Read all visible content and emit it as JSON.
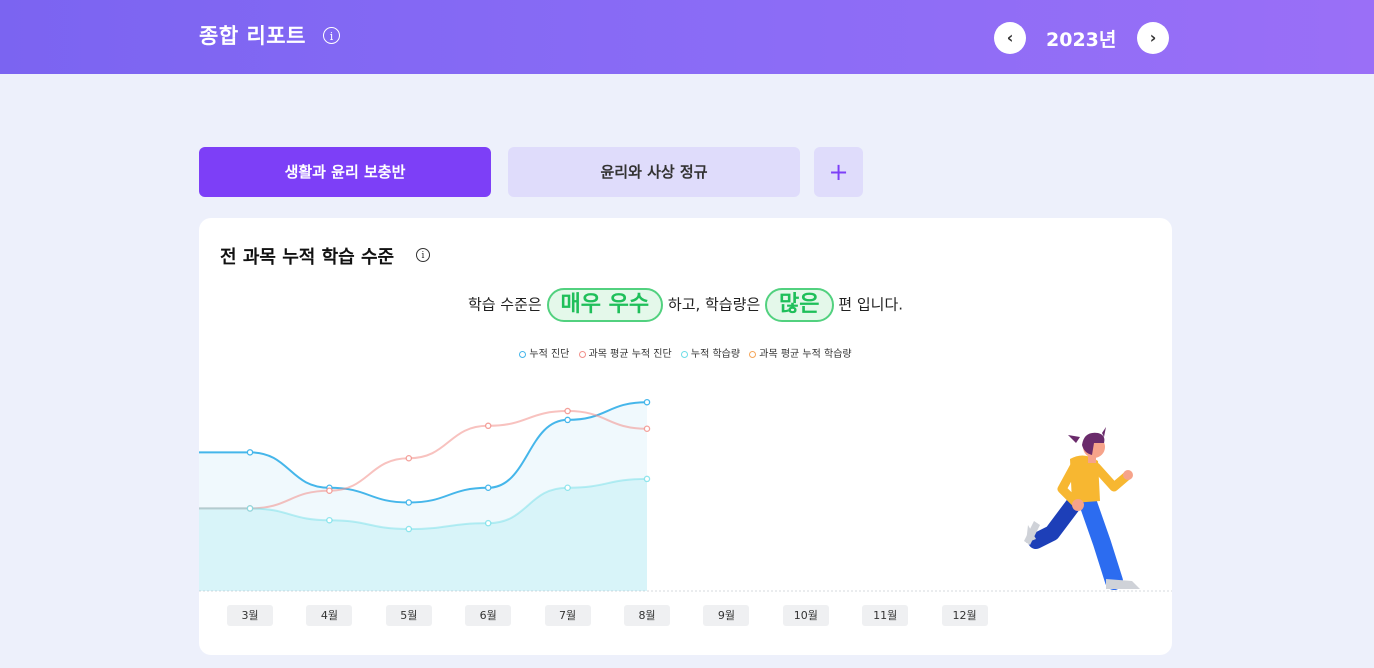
{
  "header": {
    "title": "종합 리포트",
    "info_icon": "info-icon",
    "year": "2023년",
    "prev_icon": "chevron-left-icon",
    "next_icon": "chevron-right-icon"
  },
  "tabs": [
    {
      "label": "생활과 윤리 보충반",
      "active": true
    },
    {
      "label": "윤리와 사상 정규",
      "active": false
    }
  ],
  "add_tab_label": "+",
  "card": {
    "title": "전 과목 누적 학습 수준",
    "summary": {
      "prefix": "학습 수준은",
      "level": "매우 우수",
      "middle": "하고, 학습량은",
      "amount": "많은",
      "suffix": "편 입니다."
    },
    "legend": [
      {
        "label": "누적 진단",
        "color": "#45b6ea"
      },
      {
        "label": "과목 평균 누적 진단",
        "color": "#f2908a"
      },
      {
        "label": "누적 학습량",
        "color": "#6fdde7"
      },
      {
        "label": "과목 평균 누적 학습량",
        "color": "#f5a65a"
      }
    ]
  },
  "chart_data": {
    "type": "line",
    "categories": [
      "3월",
      "4월",
      "5월",
      "6월",
      "7월",
      "8월",
      "9월",
      "10월",
      "11월",
      "12월"
    ],
    "series": [
      {
        "name": "누적 진단",
        "color": "#45b6ea",
        "values": [
          47,
          35,
          30,
          35,
          58,
          64
        ]
      },
      {
        "name": "과목 평균 누적 진단",
        "color": "#f2908a",
        "values": [
          28,
          34,
          45,
          56,
          61,
          55
        ]
      },
      {
        "name": "누적 학습량",
        "color": "#6fdde7",
        "values": [
          28,
          24,
          21,
          23,
          35,
          38
        ]
      }
    ],
    "ylim": [
      0,
      100
    ],
    "grid": false
  }
}
